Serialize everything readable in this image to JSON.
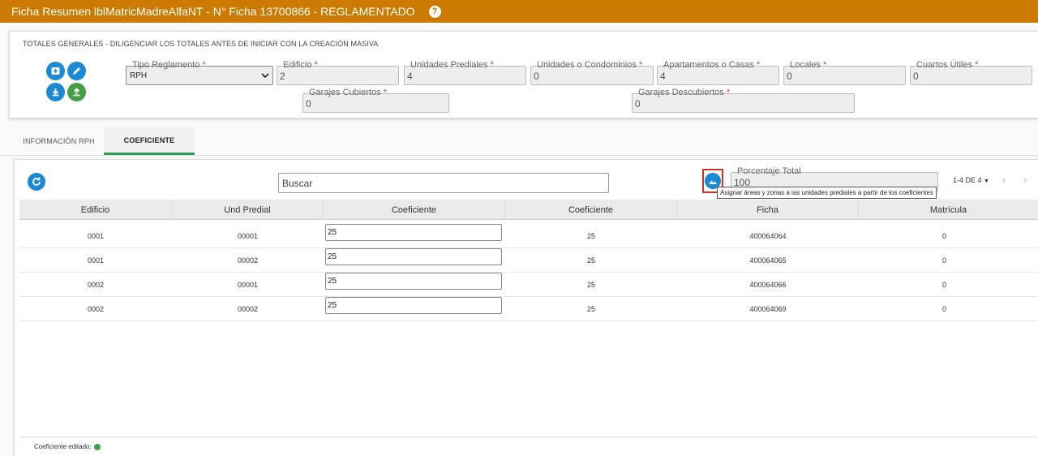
{
  "header": {
    "title": "Ficha Resumen lblMatricMadreAlfaNT - N° Ficha 13700866 - REGLAMENTADO",
    "help_icon": "question-circle-icon"
  },
  "totals": {
    "title": "TOTALES GENERALES - DILIGENCIAR LOS TOTALES ANTES DE INICIAR CON LA CREACIÓN MASIVA",
    "required_mark": "*",
    "tipo_reglamento": {
      "label": "Tipo Reglamento",
      "value": "RPH"
    },
    "edificio": {
      "label": "Edificio",
      "value": "2"
    },
    "unidades_prediales": {
      "label": "Unidades Prediales",
      "value": "4"
    },
    "unidades_condominios": {
      "label": "Unidades o Condominios",
      "value": "0"
    },
    "apartamentos_casas": {
      "label": "Apartamentos o Casas",
      "value": "4"
    },
    "locales": {
      "label": "Locales",
      "value": "0"
    },
    "cuartos_utiles": {
      "label": "Cuartos Útiles",
      "value": "0"
    },
    "garajes_cubiertos": {
      "label": "Garajes Cubiertos",
      "value": "0"
    },
    "garajes_descubiertos": {
      "label": "Garajes Descubiertos",
      "value": "0"
    }
  },
  "tabs": [
    {
      "label": "INFORMACIÓN RPH",
      "active": false
    },
    {
      "label": "COEFICIENTE",
      "active": true
    }
  ],
  "grid": {
    "search_placeholder": "Buscar",
    "porcentaje_total": {
      "label": "Porcentaje Total",
      "value": "100"
    },
    "tooltip": "Asignar áreas y zonas a las unidades prediales a partir de los coeficientes",
    "pagination": "1-4 DE 4",
    "columns": [
      "Edificio",
      "Und Predial",
      "Coeficiente",
      "Coeficiente",
      "Ficha",
      "Matrícula"
    ],
    "rows": [
      {
        "edificio": "0001",
        "und_predial": "00001",
        "coef_input": "25",
        "coeficiente": "25",
        "ficha": "400064064",
        "matricula": "0"
      },
      {
        "edificio": "0001",
        "und_predial": "00002",
        "coef_input": "25",
        "coeficiente": "25",
        "ficha": "400064065",
        "matricula": "0"
      },
      {
        "edificio": "0002",
        "und_predial": "00001",
        "coef_input": "25",
        "coeficiente": "25",
        "ficha": "400064066",
        "matricula": "0"
      },
      {
        "edificio": "0002",
        "und_predial": "00002",
        "coef_input": "25",
        "coeficiente": "25",
        "ficha": "400064069",
        "matricula": "0"
      }
    ],
    "footer_label": "Coeficiente editado:"
  },
  "colors": {
    "header": "#cc7a00",
    "accent_blue": "#1a8ad4",
    "accent_green": "#43a047",
    "tab_indicator": "#2e9e5b",
    "highlight_red": "#d32f2f"
  }
}
